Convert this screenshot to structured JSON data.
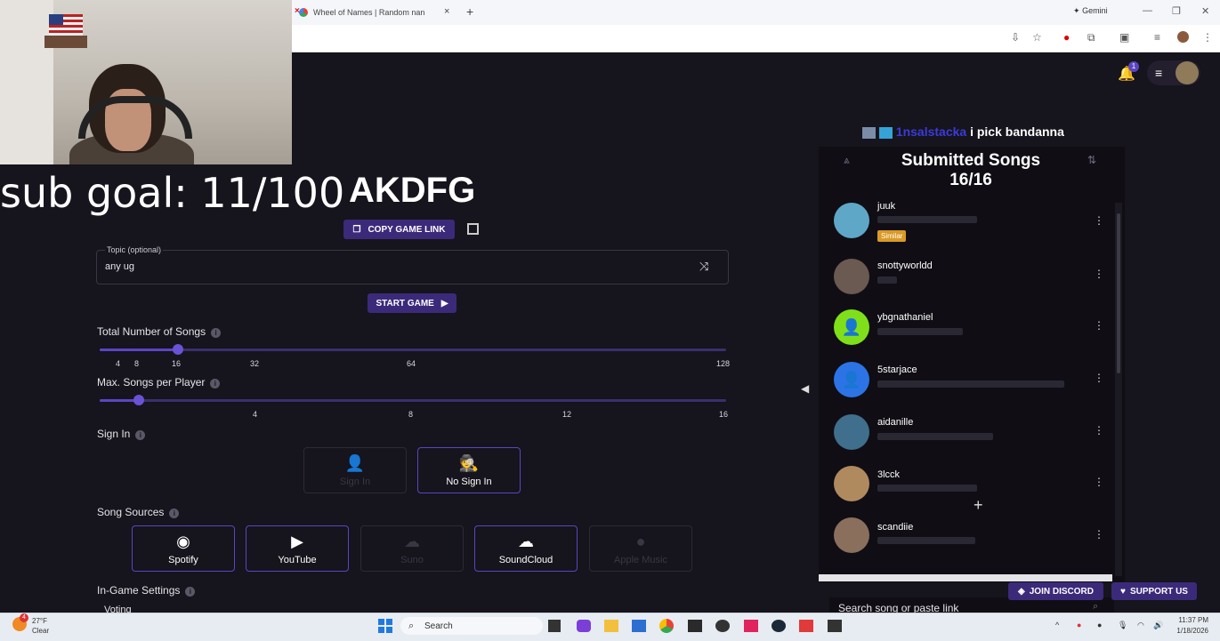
{
  "browser": {
    "tab_title": "Wheel of Names | Random nan",
    "tab_close": "×",
    "new_tab": "+",
    "gemini_label": "Gemini"
  },
  "overlay": {
    "sub_goal": "sub goal: 11/100",
    "chat_user": "1nsalstacka",
    "chat_message": "i pick bandanna"
  },
  "game": {
    "code": "AKDFG",
    "copy_link": "COPY GAME LINK",
    "topic_label": "Topic (optional)",
    "topic_value": "any ug",
    "start_game": "START GAME",
    "total_songs_label": "Total Number of Songs",
    "total_songs_value": 16,
    "total_ticks": [
      "4",
      "8",
      "16",
      "32",
      "64",
      "128"
    ],
    "max_songs_label": "Max. Songs per Player",
    "max_songs_fraction": 0.12,
    "max_ticks": [
      "4",
      "8",
      "12",
      "16"
    ],
    "sign_in_label": "Sign In",
    "sign_in_options": [
      "Sign In",
      "No Sign In"
    ],
    "sources_label": "Song Sources",
    "sources": [
      "Spotify",
      "YouTube",
      "Suno",
      "SoundCloud",
      "Apple Music"
    ],
    "in_game_label": "In-Game Settings",
    "voting_label": "Voting"
  },
  "panel": {
    "title": "Submitted Songs",
    "count": "16/16",
    "similar_badge": "Similar",
    "players": [
      {
        "name": "juuk",
        "color": "#5fa7c7"
      },
      {
        "name": "snottyworldd",
        "color": "#6b5a52"
      },
      {
        "name": "ybgnathaniel",
        "color": "#7fe01a"
      },
      {
        "name": "5starjace",
        "color": "#2c74e6"
      },
      {
        "name": "aidanille",
        "color": "#3f6f8c"
      },
      {
        "name": "3lcck",
        "color": "#b08a5f"
      },
      {
        "name": "scandiie",
        "color": "#8a6f5d"
      }
    ],
    "search_placeholder": "Search song or paste link",
    "join_discord": "JOIN DISCORD",
    "support_us": "SUPPORT US"
  },
  "taskbar": {
    "weather_temp": "27°F",
    "weather_desc": "Clear",
    "search_label": "Search",
    "time": "11:37 PM",
    "date": "1/18/2026",
    "notif_count": "1",
    "weather_badge": "4"
  }
}
